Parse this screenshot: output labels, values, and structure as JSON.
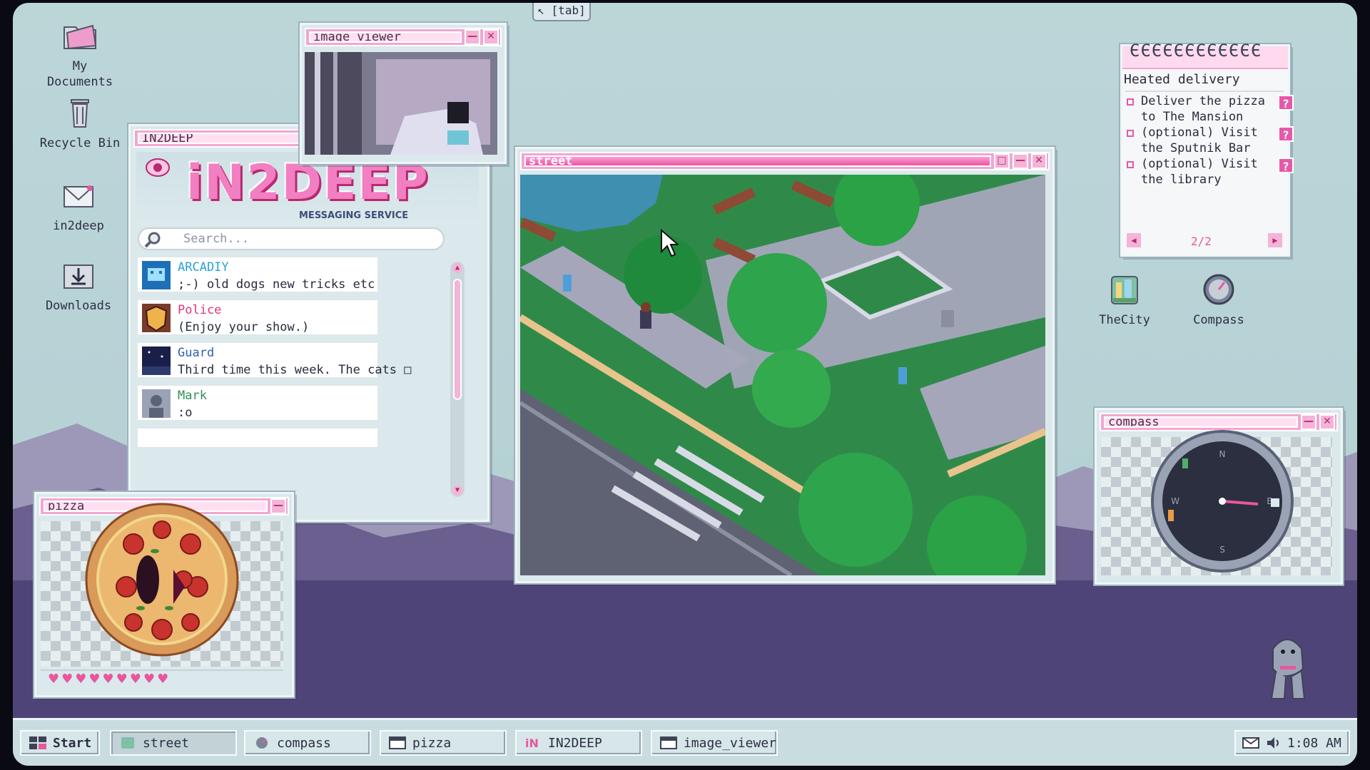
{
  "top_hint": {
    "label": "[tab]"
  },
  "desktop_icons": [
    {
      "label": "My\nDocuments",
      "icon": "folder-icon"
    },
    {
      "label": "Recycle Bin",
      "icon": "trash-icon"
    },
    {
      "label": "in2deep",
      "icon": "mail-icon"
    },
    {
      "label": "Downloads",
      "icon": "download-icon"
    },
    {
      "label": "TheCity",
      "icon": "city-icon"
    },
    {
      "label": "Compass",
      "icon": "compass-icon"
    }
  ],
  "image_viewer": {
    "title": "image_viewer"
  },
  "in2deep": {
    "title": "IN2DEEP",
    "logo": "iN2DEEP",
    "subtitle": "MESSAGING SERVICE",
    "search_placeholder": "Search...",
    "chats": [
      {
        "name": "ARCADIY",
        "message": ";-) old dogs new tricks etc",
        "name_color": "#2aa0d8"
      },
      {
        "name": "Police",
        "message": "(Enjoy your show.)",
        "name_color": "#e0357a"
      },
      {
        "name": "Guard",
        "message": "Third time this week. The cats □",
        "name_color": "#2f5fb0"
      },
      {
        "name": "Mark",
        "message": ":o",
        "name_color": "#2f8f5a"
      }
    ]
  },
  "street": {
    "title": "street"
  },
  "todo": {
    "title": "Heated delivery",
    "items": [
      "Deliver the pizza to The Mansion",
      "(optional) Visit the Sputnik Bar",
      "(optional) Visit the library"
    ],
    "page": "2/2"
  },
  "compass": {
    "title": "compass"
  },
  "pizza": {
    "title": "pizza",
    "hearts": 9
  },
  "taskbar": {
    "start": "Start",
    "tasks": [
      "street",
      "compass",
      "pizza",
      "IN2DEEP",
      "image_viewer"
    ],
    "clock": "1:08 AM"
  },
  "colors": {
    "accent": "#e8569f",
    "desktop": "#b6d2d5",
    "taskbar": "#c9dcdf"
  }
}
